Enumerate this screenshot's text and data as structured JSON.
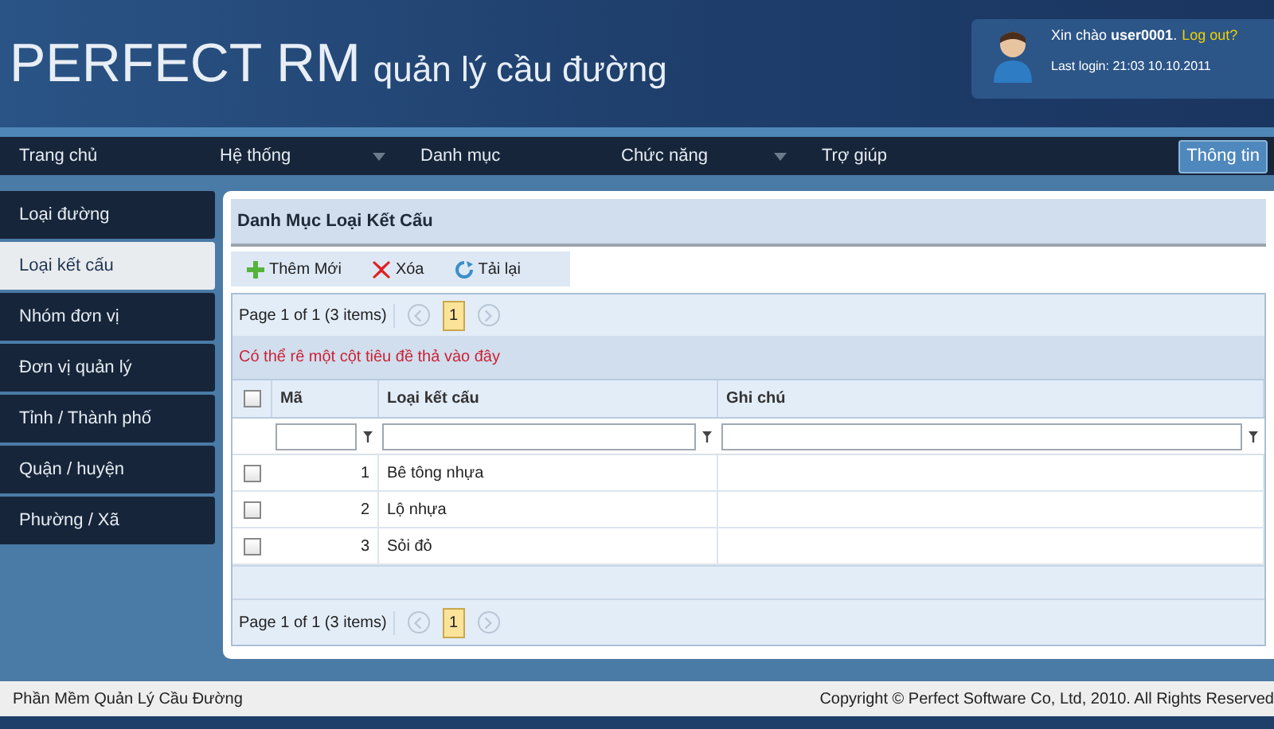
{
  "header": {
    "title": "PERFECT RM",
    "subtitle": "quản lý cầu đường",
    "user": {
      "greeting": "Xin chào **user0001**.",
      "logout": "Log out?",
      "last_login": "Last login: 21:03 10.10.2011"
    }
  },
  "nav": {
    "items": [
      {
        "label": "Trang chủ",
        "dropdown": false
      },
      {
        "label": "Hệ thống",
        "dropdown": true
      },
      {
        "label": "Danh mục",
        "dropdown": false
      },
      {
        "label": "Chức năng",
        "dropdown": true
      },
      {
        "label": "Trợ giúp",
        "dropdown": false
      }
    ],
    "info_button": "Thông tin"
  },
  "sidebar": {
    "items": [
      {
        "label": "Loại đường",
        "selected": false
      },
      {
        "label": "Loại kết cấu",
        "selected": true
      },
      {
        "label": "Nhóm đơn vị",
        "selected": false
      },
      {
        "label": "Đơn vị quản lý",
        "selected": false
      },
      {
        "label": "Tỉnh / Thành phố",
        "selected": false
      },
      {
        "label": "Quận / huyện",
        "selected": false
      },
      {
        "label": "Phường / Xã",
        "selected": false
      }
    ]
  },
  "panel": {
    "title": "Danh Mục Loại Kết Cấu",
    "toolbar": [
      {
        "kind": "add",
        "label": "Thêm Mới"
      },
      {
        "kind": "delete",
        "label": "Xóa"
      },
      {
        "kind": "reload",
        "label": "Tải lại"
      }
    ],
    "pager_top": {
      "summary": "Page 1 of 1 (3 items)",
      "page": "1"
    },
    "group_hint": "Có thể rê một cột tiêu đề thả vào đây",
    "table": {
      "select_all_checked": false,
      "columns": [
        "Mã",
        "Loại kết cấu",
        "Ghi chú"
      ],
      "rows": [
        {
          "checked": false,
          "cells": [
            "1",
            "Bê tông nhựa",
            ""
          ]
        },
        {
          "checked": false,
          "cells": [
            "2",
            "Lộ nhựa",
            ""
          ]
        },
        {
          "checked": false,
          "cells": [
            "3",
            "Sỏi đỏ",
            ""
          ]
        }
      ]
    },
    "pager_bottom": {
      "summary": "Page 1 of 1 (3 items)",
      "page": "1"
    }
  },
  "footer": {
    "left": "Phần Mềm Quản Lý Cầu Đường",
    "right": "Copyright © Perfect Software Co, Ltd, 2010. All Rights Reserved"
  }
}
